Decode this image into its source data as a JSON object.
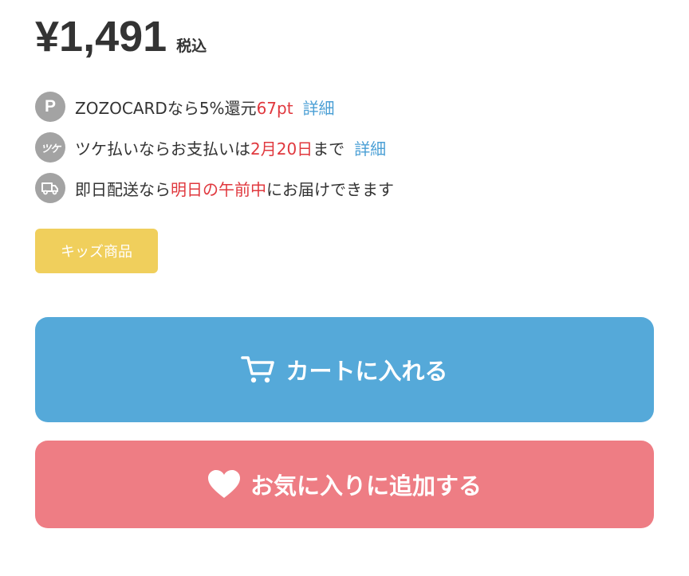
{
  "price": {
    "amount": "¥1,491",
    "tax_label": "税込"
  },
  "info": {
    "points": {
      "icon": "points-icon",
      "icon_text": "P",
      "prefix": "ZOZOCARDなら5%還元",
      "value": "67pt",
      "link": "詳細"
    },
    "tsuke": {
      "icon": "tsuke-icon",
      "icon_text": "ツケ",
      "prefix": "ツケ払いならお支払いは",
      "date": "2月20日",
      "suffix": "まで",
      "link": "詳細"
    },
    "delivery": {
      "icon": "truck-icon",
      "prefix": "即日配送なら",
      "highlight": "明日の午前中",
      "suffix": "にお届けできます"
    }
  },
  "badge": {
    "label": "キッズ商品",
    "color": "#f0cf5c"
  },
  "buttons": {
    "cart": {
      "label": "カートに入れる",
      "icon": "cart-icon",
      "color": "#55a9d9"
    },
    "favorite": {
      "label": "お気に入りに追加する",
      "icon": "heart-icon",
      "color": "#ee7d84"
    }
  },
  "colors": {
    "highlight_red": "#e0383e",
    "link_blue": "#4a9fd5",
    "icon_gray": "#a3a3a3"
  }
}
